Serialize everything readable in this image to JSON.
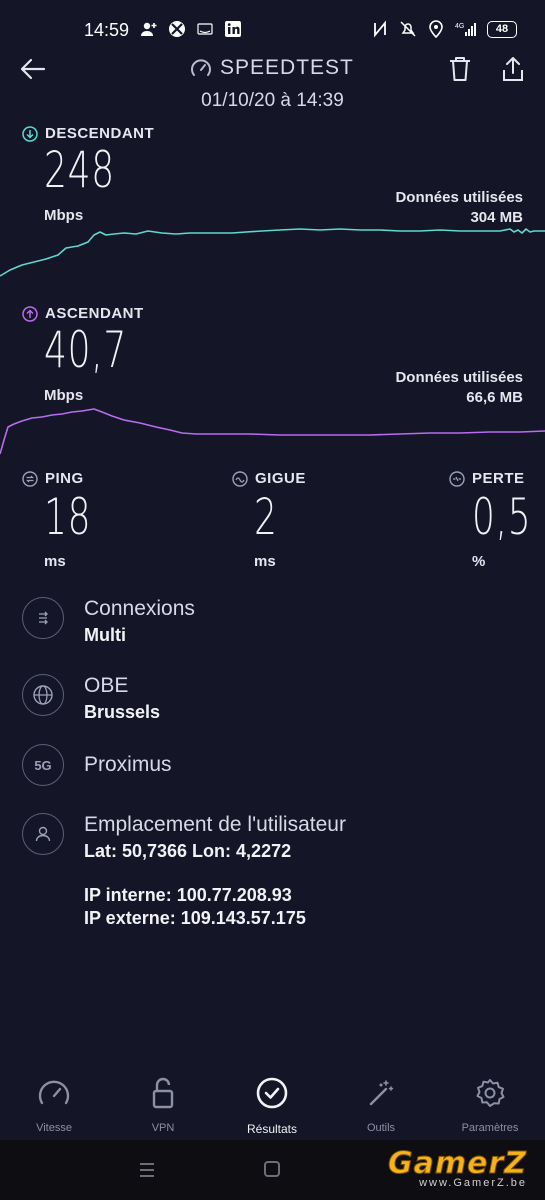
{
  "status_bar": {
    "time": "14:59",
    "battery": "48"
  },
  "header": {
    "title": "SPEEDTEST",
    "datetime": "01/10/20 à 14:39"
  },
  "download": {
    "label": "DESCENDANT",
    "value": "248",
    "unit": "Mbps",
    "data_used_label": "Données utilisées",
    "data_used_value": "304 MB",
    "color": "#5fd8d0"
  },
  "upload": {
    "label": "ASCENDANT",
    "value": "40,7",
    "unit": "Mbps",
    "data_used_label": "Données utilisées",
    "data_used_value": "66,6 MB",
    "color": "#b86cf0"
  },
  "metrics": {
    "ping": {
      "label": "PING",
      "value": "18",
      "unit": "ms"
    },
    "jitter": {
      "label": "GIGUE",
      "value": "2",
      "unit": "ms"
    },
    "loss": {
      "label": "PERTE",
      "value": "0,5",
      "unit": "%"
    }
  },
  "info": {
    "connections": {
      "title": "Connexions",
      "value": "Multi"
    },
    "server": {
      "title": "OBE",
      "value": "Brussels"
    },
    "network_badge": "5G",
    "provider": {
      "title": "Proximus"
    },
    "location": {
      "title": "Emplacement de l'utilisateur",
      "coords": "Lat: 50,7366 Lon: 4,2272",
      "ip_internal": "IP interne: 100.77.208.93",
      "ip_external": "IP externe: 109.143.57.175"
    }
  },
  "nav": {
    "items": [
      {
        "label": "Vitesse",
        "icon": "speedometer-icon"
      },
      {
        "label": "VPN",
        "icon": "lock-icon"
      },
      {
        "label": "Résultats",
        "icon": "check-circle-icon",
        "active": true
      },
      {
        "label": "Outils",
        "icon": "magic-wand-icon"
      },
      {
        "label": "Paramètres",
        "icon": "gear-icon"
      }
    ]
  },
  "watermark": {
    "logo": "GamerZ",
    "url": "www.GamerZ.be"
  }
}
